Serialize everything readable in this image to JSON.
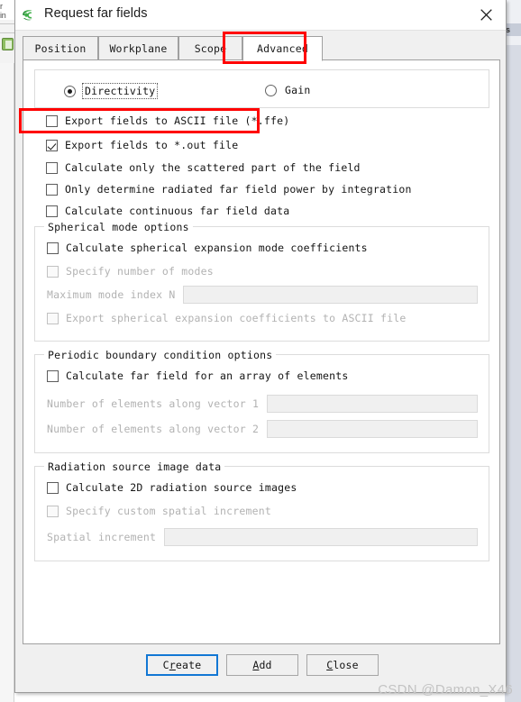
{
  "background": {
    "left_text_line1": "r",
    "left_text_line2": "in",
    "right_text": "s"
  },
  "window": {
    "title": "Request far fields",
    "app_icon": "feko-icon",
    "close_icon": "close-icon"
  },
  "tabs": [
    {
      "label": "Position",
      "active": false
    },
    {
      "label": "Workplane",
      "active": false
    },
    {
      "label": "Scope",
      "active": false
    },
    {
      "label": "Advanced",
      "active": true
    }
  ],
  "mode_options": {
    "directivity": {
      "label": "Directivity",
      "selected": true,
      "focused": true
    },
    "gain": {
      "label": "Gain",
      "selected": false,
      "focused": false
    }
  },
  "main_checkboxes": [
    {
      "label": "Export fields to ASCII file (*.ffe)",
      "checked": false,
      "enabled": true
    },
    {
      "label": "Export fields to *.out file",
      "checked": true,
      "enabled": true
    },
    {
      "label": "Calculate only the scattered part of the field",
      "checked": false,
      "enabled": true
    },
    {
      "label": "Only determine radiated far field power by integration",
      "checked": false,
      "enabled": true
    },
    {
      "label": "Calculate continuous far field data",
      "checked": false,
      "enabled": true
    }
  ],
  "spherical_group": {
    "title": "Spherical mode options",
    "checkbox_calculate": {
      "label": "Calculate spherical expansion mode coefficients",
      "checked": false,
      "enabled": true
    },
    "checkbox_specify": {
      "label": "Specify number of modes",
      "checked": false,
      "enabled": false
    },
    "field_max_mode": {
      "label": "Maximum mode index N",
      "value": "",
      "enabled": false
    },
    "checkbox_export": {
      "label": "Export spherical expansion coefficients to ASCII file",
      "checked": false,
      "enabled": false
    }
  },
  "periodic_group": {
    "title": "Periodic boundary condition options",
    "checkbox_array": {
      "label": "Calculate far field for an array of elements",
      "checked": false,
      "enabled": true
    },
    "field_vector1": {
      "label": "Number of elements along vector 1",
      "value": "",
      "enabled": false
    },
    "field_vector2": {
      "label": "Number of elements along vector 2",
      "value": "",
      "enabled": false
    }
  },
  "radiation_group": {
    "title": "Radiation source image data",
    "checkbox_2d": {
      "label": "Calculate 2D radiation source images",
      "checked": false,
      "enabled": true
    },
    "checkbox_custom": {
      "label": "Specify custom spatial increment",
      "checked": false,
      "enabled": false
    },
    "field_increment": {
      "label": "Spatial increment",
      "value": "",
      "enabled": false
    }
  },
  "footer": {
    "create": {
      "pre": "C",
      "accel": "r",
      "post": "eate",
      "default": true
    },
    "add": {
      "pre": "",
      "accel": "A",
      "post": "dd",
      "default": false
    },
    "close": {
      "pre": "",
      "accel": "C",
      "post": "lose",
      "default": false
    }
  },
  "annotations": {
    "highlight_color": "#ff0000",
    "boxes": [
      "advanced-tab",
      "export-ascii-checkbox"
    ]
  },
  "watermark": {
    "text": "CSDN @Damon_X46"
  }
}
